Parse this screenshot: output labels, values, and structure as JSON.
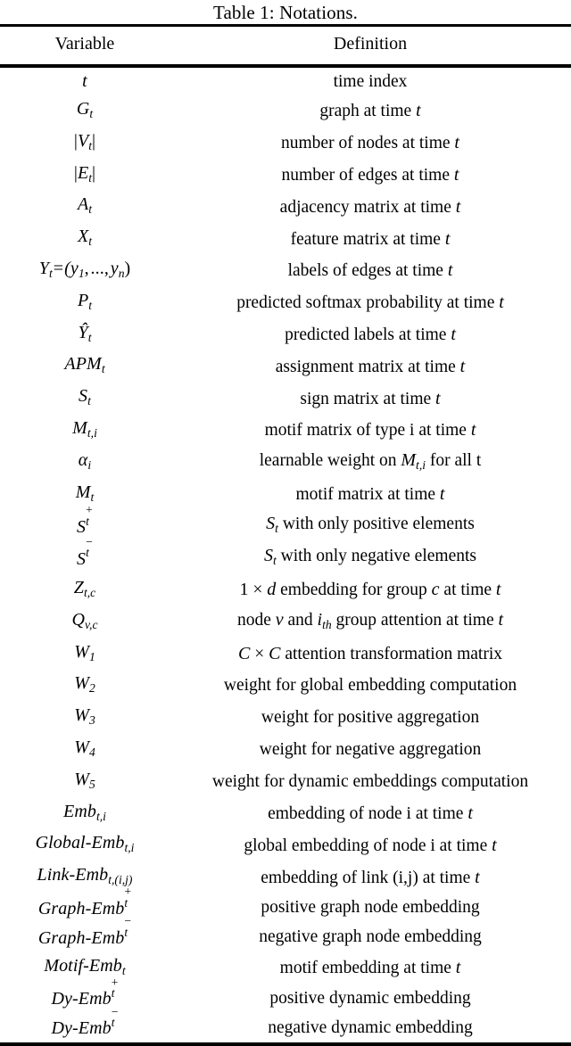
{
  "caption": "Table 1: Notations.",
  "columns": {
    "variable": "Variable",
    "definition": "Definition"
  },
  "rows": [
    {
      "variable": "t",
      "definition": "time index"
    },
    {
      "variable": "G_t",
      "definition": "graph at time t"
    },
    {
      "variable": "|V_t|",
      "definition": "number of nodes at time t"
    },
    {
      "variable": "|E_t|",
      "definition": "number of edges at time t"
    },
    {
      "variable": "A_t",
      "definition": "adjacency matrix at time t"
    },
    {
      "variable": "X_t",
      "definition": "feature matrix at time t"
    },
    {
      "variable": "Y_t = (y_1, ..., y_n)",
      "definition": "labels of edges at time t"
    },
    {
      "variable": "P_t",
      "definition": "predicted softmax probability at time t"
    },
    {
      "variable": "Ŷ_t",
      "definition": "predicted labels at time t"
    },
    {
      "variable": "APM_t",
      "definition": "assignment matrix at time t"
    },
    {
      "variable": "S_t",
      "definition": "sign matrix at time t"
    },
    {
      "variable": "M_t,i",
      "definition": "motif matrix of type i at time t"
    },
    {
      "variable": "α_i",
      "definition": "learnable weight on M_t,i for all t"
    },
    {
      "variable": "M_t",
      "definition": "motif matrix at time t"
    },
    {
      "variable": "S_t^+",
      "definition": "S_t with only positive elements"
    },
    {
      "variable": "S_t^-",
      "definition": "S_t with only negative elements"
    },
    {
      "variable": "Z_t,c",
      "definition": "1 × d embedding for group c at time t"
    },
    {
      "variable": "Q_v,c",
      "definition": "node v and i_th group attention at time t"
    },
    {
      "variable": "W_1",
      "definition": "C × C attention transformation matrix"
    },
    {
      "variable": "W_2",
      "definition": "weight for global embedding computation"
    },
    {
      "variable": "W_3",
      "definition": "weight for positive aggregation"
    },
    {
      "variable": "W_4",
      "definition": "weight for negative aggregation"
    },
    {
      "variable": "W_5",
      "definition": "weight for dynamic embeddings computation"
    },
    {
      "variable": "Emb_t,i",
      "definition": "embedding of node i at time t"
    },
    {
      "variable": "Global-Emb_t,i",
      "definition": "global embedding of node i at time t"
    },
    {
      "variable": "Link-Emb_t,(i,j)",
      "definition": "embedding of link (i,j) at time t"
    },
    {
      "variable": "Graph-Emb_t^+",
      "definition": "positive graph node embedding"
    },
    {
      "variable": "Graph-Emb_t^-",
      "definition": "negative graph node embedding"
    },
    {
      "variable": "Motif-Emb_t",
      "definition": "motif embedding at time t"
    },
    {
      "variable": "Dy-Emb_t^+",
      "definition": "positive dynamic embedding"
    },
    {
      "variable": "Dy-Emb_t^-",
      "definition": "negative dynamic embedding"
    }
  ]
}
